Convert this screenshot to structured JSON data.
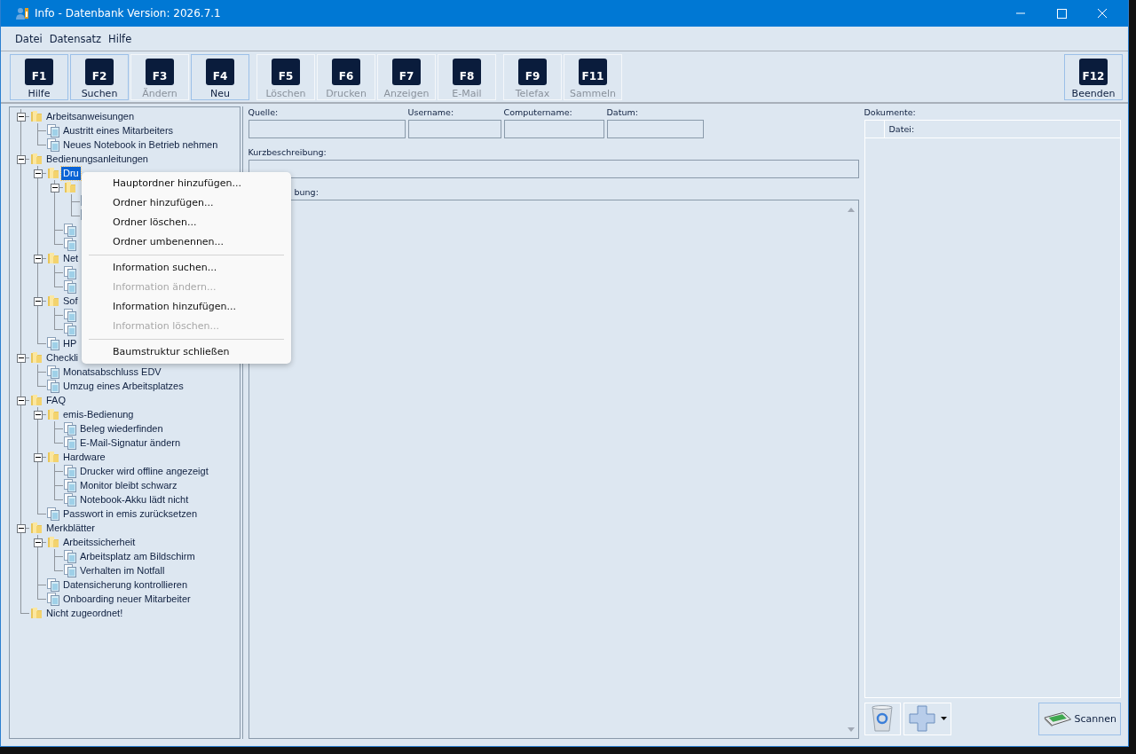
{
  "window": {
    "title": "Info - Datenbank Version: 2026.7.1"
  },
  "menu": [
    "Datei",
    "Datensatz",
    "Hilfe"
  ],
  "toolbar": {
    "groups": [
      {
        "buttons": [
          {
            "key": "F1",
            "label": "Hilfe",
            "disabled": false
          },
          {
            "key": "F2",
            "label": "Suchen",
            "disabled": false
          },
          {
            "key": "F3",
            "label": "Ändern",
            "disabled": true
          },
          {
            "key": "F4",
            "label": "Neu",
            "disabled": false
          }
        ]
      },
      {
        "buttons": [
          {
            "key": "F5",
            "label": "Löschen",
            "disabled": true
          },
          {
            "key": "F6",
            "label": "Drucken",
            "disabled": true
          },
          {
            "key": "F7",
            "label": "Anzeigen",
            "disabled": true
          },
          {
            "key": "F8",
            "label": "E-Mail",
            "disabled": true
          }
        ]
      },
      {
        "buttons": [
          {
            "key": "F9",
            "label": "Telefax",
            "disabled": true
          },
          {
            "key": "F11",
            "label": "Sammeln",
            "disabled": true
          }
        ]
      },
      {
        "buttons": [
          {
            "key": "F12",
            "label": "Beenden",
            "disabled": false
          }
        ]
      }
    ]
  },
  "tree": [
    {
      "kind": "folder",
      "label": "Arbeitsanweisungen",
      "selected": false,
      "expanded": true,
      "children": [
        {
          "kind": "document",
          "label": "Austritt eines Mitarbeiters",
          "selected": false
        },
        {
          "kind": "document",
          "label": "Neues Notebook in Betrieb nehmen",
          "selected": false
        }
      ]
    },
    {
      "kind": "folder",
      "label": "Bedienungsanleitungen",
      "selected": false,
      "expanded": true,
      "children": [
        {
          "kind": "folder",
          "label": "Dru",
          "selected": true,
          "expanded": true,
          "children": [
            {
              "kind": "folder",
              "expanded": true,
              "children": [
                {
                  "kind": "document"
                },
                {
                  "kind": "document"
                }
              ]
            },
            {
              "kind": "document"
            },
            {
              "kind": "document"
            }
          ]
        },
        {
          "kind": "folder",
          "label": "Net",
          "selected": false,
          "expanded": true,
          "children": [
            {
              "kind": "document"
            },
            {
              "kind": "document"
            }
          ]
        },
        {
          "kind": "folder",
          "label": "Sof",
          "selected": false,
          "expanded": true,
          "children": [
            {
              "kind": "document"
            },
            {
              "kind": "document"
            }
          ]
        },
        {
          "kind": "document",
          "label": "HP",
          "selected": false
        }
      ]
    },
    {
      "kind": "folder",
      "label": "Checkli",
      "selected": false,
      "expanded": true,
      "children": [
        {
          "kind": "document",
          "label": "Monatsabschluss EDV",
          "selected": false
        },
        {
          "kind": "document",
          "label": "Umzug eines Arbeitsplatzes",
          "selected": false
        }
      ]
    },
    {
      "kind": "folder",
      "label": "FAQ",
      "selected": false,
      "expanded": true,
      "children": [
        {
          "kind": "folder",
          "label": "emis-Bedienung",
          "selected": false,
          "expanded": true,
          "children": [
            {
              "kind": "document",
              "label": "Beleg wiederfinden",
              "selected": false
            },
            {
              "kind": "document",
              "label": "E-Mail-Signatur ändern",
              "selected": false
            }
          ]
        },
        {
          "kind": "folder",
          "label": "Hardware",
          "selected": false,
          "expanded": true,
          "children": [
            {
              "kind": "document",
              "label": "Drucker wird offline angezeigt",
              "selected": false
            },
            {
              "kind": "document",
              "label": "Monitor bleibt schwarz",
              "selected": false
            },
            {
              "kind": "document",
              "label": "Notebook-Akku lädt nicht",
              "selected": false
            }
          ]
        },
        {
          "kind": "document",
          "label": "Passwort in emis zurücksetzen",
          "selected": false
        }
      ]
    },
    {
      "kind": "folder",
      "label": "Merkblätter",
      "selected": false,
      "expanded": true,
      "children": [
        {
          "kind": "folder",
          "label": "Arbeitssicherheit",
          "selected": false,
          "expanded": true,
          "children": [
            {
              "kind": "document",
              "label": "Arbeitsplatz am Bildschirm",
              "selected": false
            },
            {
              "kind": "document",
              "label": "Verhalten im Notfall",
              "selected": false
            }
          ]
        },
        {
          "kind": "document",
          "label": "Datensicherung kontrollieren",
          "selected": false
        },
        {
          "kind": "document",
          "label": "Onboarding neuer Mitarbeiter",
          "selected": false
        }
      ]
    },
    {
      "kind": "folder",
      "label": "Nicht zugeordnet!",
      "selected": false
    }
  ],
  "context_menu": [
    {
      "kind": "item",
      "label": "Hauptordner hinzufügen...",
      "disabled": false
    },
    {
      "kind": "item",
      "label": "Ordner hinzufügen...",
      "disabled": false
    },
    {
      "kind": "item",
      "label": "Ordner löschen...",
      "disabled": false
    },
    {
      "kind": "item",
      "label": "Ordner umbenennen...",
      "disabled": false
    },
    {
      "kind": "separator"
    },
    {
      "kind": "item",
      "label": "Information suchen...",
      "disabled": false
    },
    {
      "kind": "item",
      "label": "Information ändern...",
      "disabled": true
    },
    {
      "kind": "item",
      "label": "Information hinzufügen...",
      "disabled": false
    },
    {
      "kind": "item",
      "label": "Information löschen...",
      "disabled": true
    },
    {
      "kind": "separator"
    },
    {
      "kind": "item",
      "label": "Baumstruktur schließen",
      "disabled": false
    }
  ],
  "form": {
    "fields": [
      {
        "label": "Quelle:"
      },
      {
        "label": "Username:"
      },
      {
        "label": "Computername:"
      },
      {
        "label": "Datum:"
      }
    ],
    "summary_label": "Kurzbeschreibung:",
    "description_label": "bung:"
  },
  "documents": {
    "label": "Dokumente:",
    "columns": [
      "Datei:"
    ]
  },
  "scan_button": "Scannen"
}
